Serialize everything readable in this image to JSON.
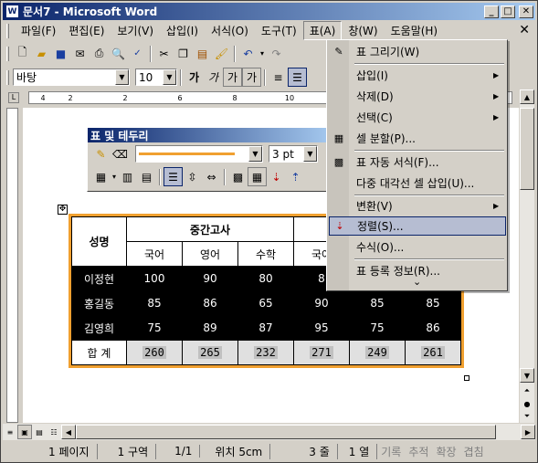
{
  "window": {
    "title": "문서7 - Microsoft Word",
    "app_icon_text": "W"
  },
  "menubar": {
    "items": [
      "파일(F)",
      "편집(E)",
      "보기(V)",
      "삽입(I)",
      "서식(O)",
      "도구(T)",
      "표(A)",
      "창(W)",
      "도움말(H)"
    ],
    "close_glyph": "✕"
  },
  "toolbar1": {
    "icons": [
      "new-doc",
      "open",
      "save",
      "email",
      "print",
      "print-preview",
      "spelling",
      "cut",
      "copy",
      "paste",
      "format-painter",
      "undo",
      "redo"
    ]
  },
  "formatting": {
    "font": "바탕",
    "size": "10",
    "buttons": [
      "가",
      "가",
      "가",
      "가"
    ]
  },
  "ruler_marks": [
    "4",
    "2",
    "",
    "2",
    "",
    "6",
    "",
    "8",
    "",
    "10",
    "",
    "12"
  ],
  "float_toolbar": {
    "title": "표 및 테두리",
    "line_weight": "3 pt"
  },
  "table_menu": {
    "items": [
      {
        "label": "표 그리기(W)",
        "icon": "pencil",
        "submenu": false,
        "highlight": false
      },
      {
        "label": "삽입(I)",
        "icon": "",
        "submenu": true,
        "highlight": false
      },
      {
        "label": "삭제(D)",
        "icon": "",
        "submenu": true,
        "highlight": false
      },
      {
        "label": "선택(C)",
        "icon": "",
        "submenu": true,
        "highlight": false
      },
      {
        "label": "셀 분할(P)...",
        "icon": "grid",
        "submenu": false,
        "highlight": false
      },
      {
        "label": "표 자동 서식(F)...",
        "icon": "grid",
        "submenu": false,
        "highlight": false
      },
      {
        "label": "다중 대각선 셀 삽입(U)...",
        "icon": "",
        "submenu": false,
        "highlight": false
      },
      {
        "label": "변환(V)",
        "icon": "",
        "submenu": true,
        "highlight": false
      },
      {
        "label": "정렬(S)...",
        "icon": "sort",
        "submenu": false,
        "highlight": true
      },
      {
        "label": "수식(O)...",
        "icon": "",
        "submenu": false,
        "highlight": false
      },
      {
        "label": "표 등록 정보(R)...",
        "icon": "",
        "submenu": false,
        "highlight": false
      }
    ],
    "more_glyph": "⌄"
  },
  "grade_table": {
    "header_name": "성명",
    "header_group": "중간고사",
    "subjects": [
      "국어",
      "영어",
      "수학",
      "국어",
      "",
      ""
    ],
    "rows": [
      {
        "name": "이정현",
        "scores": [
          "100",
          "90",
          "80",
          "8",
          "",
          ""
        ]
      },
      {
        "name": "홍길동",
        "scores": [
          "85",
          "86",
          "65",
          "90",
          "85",
          "85"
        ]
      },
      {
        "name": "김영희",
        "scores": [
          "75",
          "89",
          "87",
          "95",
          "75",
          "86"
        ]
      }
    ],
    "total_label": "합 계",
    "totals": [
      "260",
      "265",
      "232",
      "271",
      "249",
      "261"
    ]
  },
  "status": {
    "page": "1 페이지",
    "section": "1 구역",
    "pages": "1/1",
    "position": "위치 5cm",
    "line": "3 줄",
    "column": "1 열",
    "modes": [
      "기록",
      "추적",
      "확장",
      "겹침"
    ]
  }
}
